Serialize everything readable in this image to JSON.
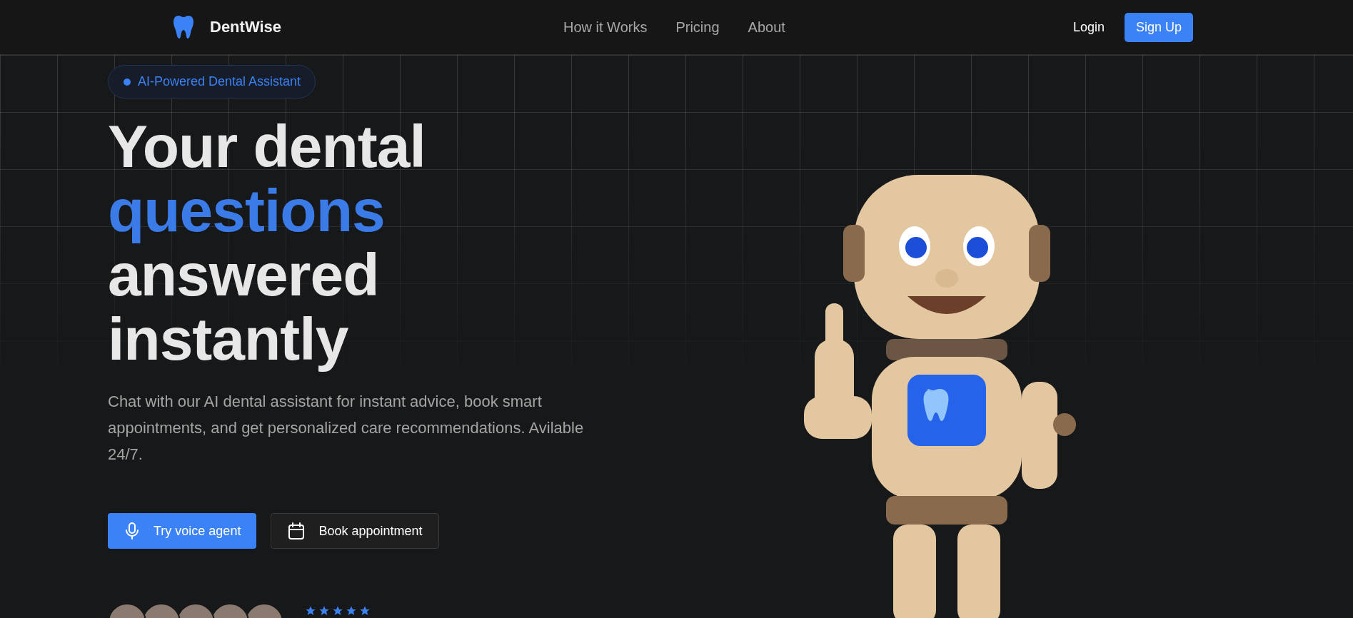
{
  "nav": {
    "brand": "DentWise",
    "links": [
      "How it Works",
      "Pricing",
      "About"
    ],
    "login": "Login",
    "signup": "Sign Up"
  },
  "hero": {
    "badge": "AI-Powered Dental Assistant",
    "headline": [
      {
        "text": "Your dental",
        "accent": false
      },
      {
        "text": "questions",
        "accent": true
      },
      {
        "text": "answered",
        "accent": false
      },
      {
        "text": "instantly",
        "accent": false
      }
    ],
    "description": "Chat with our AI dental assistant for instant advice, book smart appointments, and get personalized care recommendations. Avilable 24/7.",
    "buttons": [
      {
        "label": "Try voice agent",
        "kind": "primary"
      },
      {
        "label": "Book appointment",
        "kind": "secondary"
      }
    ],
    "social_proof": {
      "stars": 5
    }
  }
}
